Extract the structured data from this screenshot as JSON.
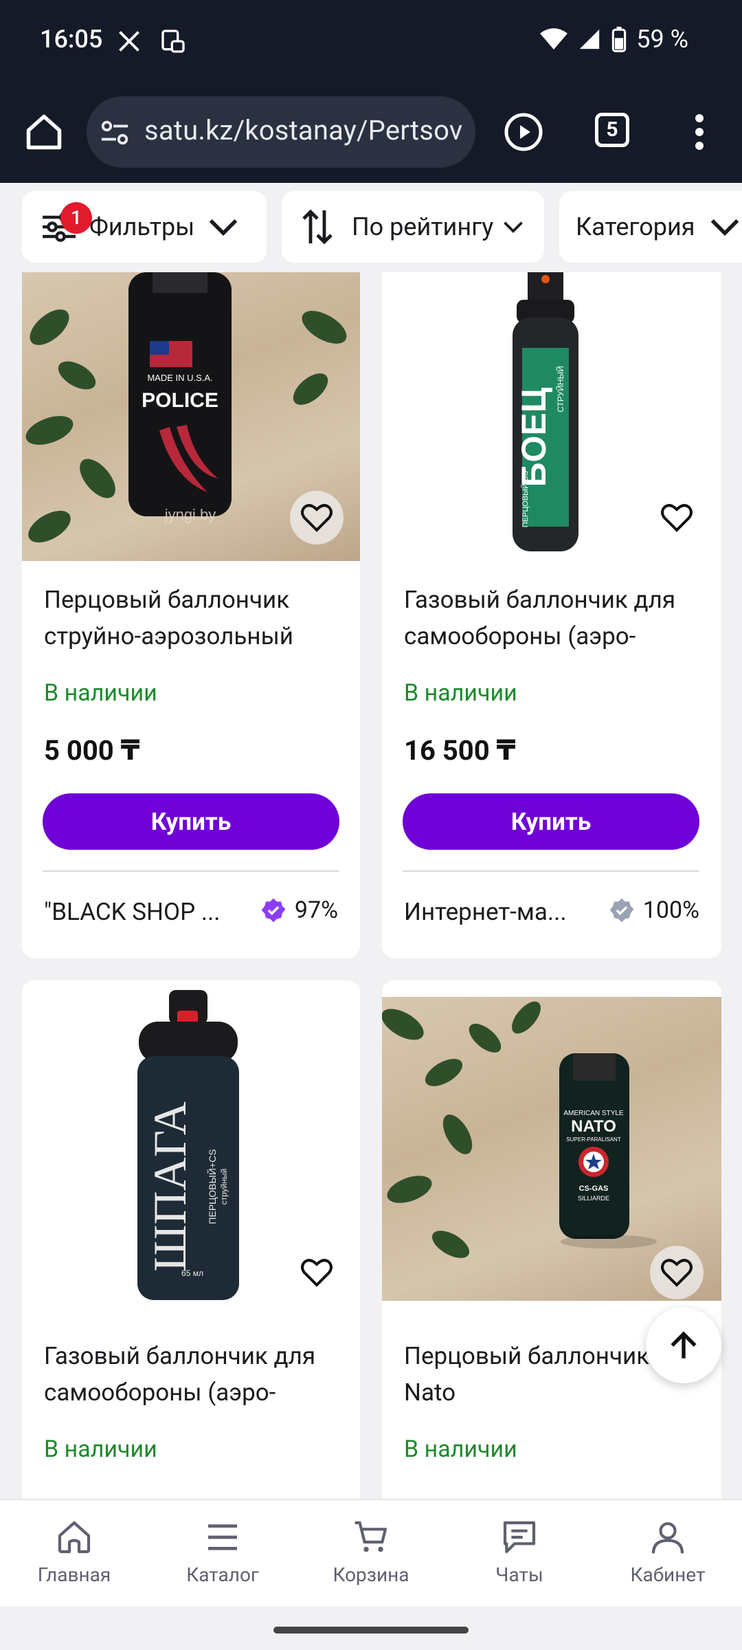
{
  "status_bar": {
    "time": "16:05",
    "battery": "59 %",
    "icons_left": [
      "x-icon",
      "sim-icon"
    ],
    "icons_right": [
      "wifi-icon",
      "signal-icon",
      "battery-icon"
    ]
  },
  "browser": {
    "url": "satu.kz/kostanay/Pertsov",
    "tab_count": "5"
  },
  "filters": {
    "filters_label": "Фильтры",
    "filters_badge": "1",
    "sort_label": "По рейтингу",
    "category_label": "Категория"
  },
  "products": [
    {
      "title": "Перцовый баллончик струйно-аэрозольный",
      "stock": "В наличии",
      "price": "5 000 ₸",
      "buy_label": "Купить",
      "seller": "\"BLACK SHOP ...",
      "rating": "97%",
      "rating_color": "#8b3df5",
      "image_text": [
        "MADE IN U.S.A.",
        "POLICE"
      ],
      "watermark": "jyngi.by"
    },
    {
      "title": "Газовый баллончик для самообороны (аэро-",
      "stock": "В наличии",
      "price": "16 500 ₸",
      "buy_label": "Купить",
      "seller": "Интернет-ма...",
      "rating": "100%",
      "rating_color": "#9aa3b5",
      "image_text": [
        "БОЕЦ",
        "СТРУЙНЫЙ",
        "ПЕРЦОВЫЙ CS"
      ]
    },
    {
      "title": "Газовый баллончик для самообороны (аэро-",
      "stock": "В наличии",
      "image_text": [
        "ШПАГА",
        "ПЕРЦОВЫЙ+CS",
        "струйный",
        "65 мл"
      ]
    },
    {
      "title": "Перцовый баллончик Nato",
      "stock": "В наличии",
      "image_text": [
        "AMERICAN STYLE",
        "NATO",
        "SUPER-PARALISANT",
        "CS-GAS",
        "SILLIARDE"
      ]
    }
  ],
  "bottom_nav": [
    {
      "label": "Главная",
      "icon": "home-icon"
    },
    {
      "label": "Каталог",
      "icon": "menu-icon"
    },
    {
      "label": "Корзина",
      "icon": "cart-icon"
    },
    {
      "label": "Чаты",
      "icon": "chat-icon"
    },
    {
      "label": "Кабинет",
      "icon": "user-icon"
    }
  ],
  "colors": {
    "accent": "#7000d8",
    "in_stock": "#1e8a2b",
    "browser_bar": "#141a27",
    "badge": "#e01b2b"
  }
}
